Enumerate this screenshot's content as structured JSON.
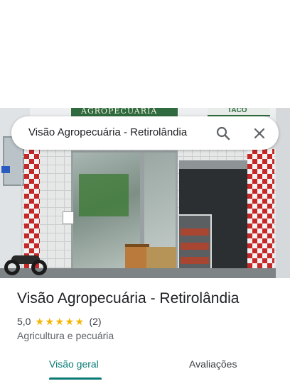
{
  "search": {
    "query": "Visão Agropecuária - Retirolândia",
    "search_icon": "search-icon",
    "close_icon": "close-icon"
  },
  "hero": {
    "sign_text": "AGROPECUÁRIA",
    "sign_text_right": "TACO"
  },
  "place": {
    "name": "Visão Agropecuária - Retirolândia",
    "rating": "5,0",
    "stars": 5,
    "reviews": "(2)",
    "category": "Agricultura e pecuária"
  },
  "tabs": [
    {
      "label": "Visão geral",
      "active": true
    },
    {
      "label": "Avaliações",
      "active": false
    }
  ],
  "colors": {
    "accent": "#0b7a75",
    "star": "#f4b400",
    "text": "#202124",
    "muted": "#5f6368"
  }
}
